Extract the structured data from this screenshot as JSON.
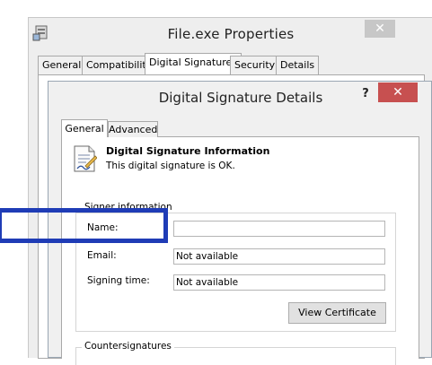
{
  "outer_window": {
    "title": "File.exe Properties",
    "close_glyph": "✕",
    "icon": "properties-app-icon",
    "tabs": [
      "General",
      "Compatibility",
      "Digital Signatures",
      "Security",
      "Details"
    ],
    "active_tab": "Digital Signatures"
  },
  "dialog": {
    "title": "Digital Signature Details",
    "help_glyph": "?",
    "close_glyph": "✕",
    "tabs": [
      "General",
      "Advanced"
    ],
    "active_tab": "General",
    "info_heading": "Digital Signature Information",
    "info_status": "This digital signature is OK.",
    "info_icon": "certificate-icon",
    "signer_group_label": "Signer information",
    "name_label": "Name:",
    "name_value": "",
    "email_label": "Email:",
    "email_value": "Not available",
    "signing_time_label": "Signing time:",
    "signing_time_value": "Not available",
    "view_certificate_label": "View Certificate",
    "countersignatures_label": "Countersignatures"
  },
  "colors": {
    "highlight": "#1f3cb6",
    "close_red": "#c75050"
  }
}
